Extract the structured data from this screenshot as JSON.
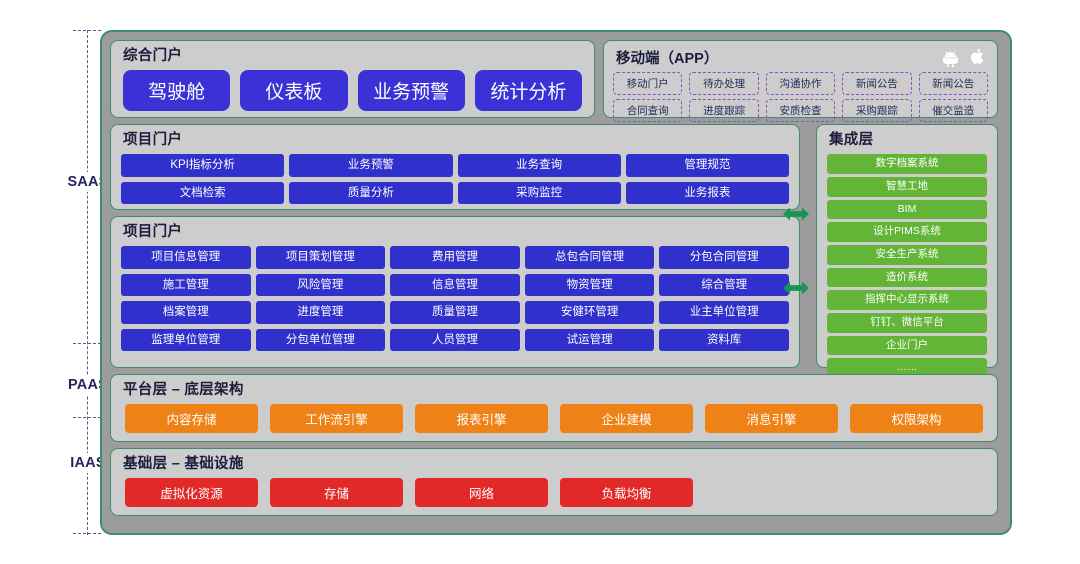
{
  "axis_labels": [
    {
      "id": "saas",
      "text": "SAAS"
    },
    {
      "id": "paas",
      "text": "PAAS"
    },
    {
      "id": "iaas",
      "text": "IAAS"
    }
  ],
  "colors": {
    "blue": "#3030cc",
    "green": "#62b536",
    "orange": "#ef8216",
    "red": "#e12a28",
    "purple_dashed": "#8a4fc4",
    "panel_bg": "#cdcdcd",
    "shell_bg": "#9c9c9c",
    "border_green": "#3e8d6e"
  },
  "portal": {
    "title": "综合门户",
    "items": [
      "驾驶舱",
      "仪表板",
      "业务预警",
      "统计分析"
    ]
  },
  "mobile": {
    "title": "移动端（APP）",
    "icons": [
      "android-icon",
      "apple-icon"
    ],
    "items": [
      "移动门户",
      "待办处理",
      "沟通协作",
      "新闻公告",
      "新闻公告",
      "合同查询",
      "进度跟踪",
      "安质检查",
      "采购跟踪",
      "催交监造"
    ]
  },
  "kpi": {
    "title": "项目门户",
    "items": [
      "KPI指标分析",
      "业务预警",
      "业务查询",
      "管理规范",
      "文档检索",
      "质量分析",
      "采购监控",
      "业务报表"
    ]
  },
  "modules": {
    "title": "项目门户",
    "items": [
      "项目信息管理",
      "项目策划管理",
      "费用管理",
      "总包合同管理",
      "分包合同管理",
      "施工管理",
      "风险管理",
      "信息管理",
      "物资管理",
      "综合管理",
      "档案管理",
      "进度管理",
      "质量管理",
      "安健环管理",
      "业主单位管理",
      "监理单位管理",
      "分包单位管理",
      "人员管理",
      "试运管理",
      "资料库"
    ]
  },
  "integration": {
    "title": "集成层",
    "items": [
      "数字档案系统",
      "智慧工地",
      "BIM",
      "设计PIMS系统",
      "安全生产系统",
      "造价系统",
      "指挥中心显示系统",
      "钉钉、微信平台",
      "企业门户",
      "……"
    ]
  },
  "paas": {
    "title": "平台层 – 底层架构",
    "items": [
      "内容存储",
      "工作流引擎",
      "报表引擎",
      "企业建模",
      "消息引擎",
      "权限架构"
    ]
  },
  "iaas": {
    "title": "基础层 – 基础设施",
    "items": [
      "虚拟化资源",
      "存储",
      "网络",
      "负载均衡"
    ]
  }
}
